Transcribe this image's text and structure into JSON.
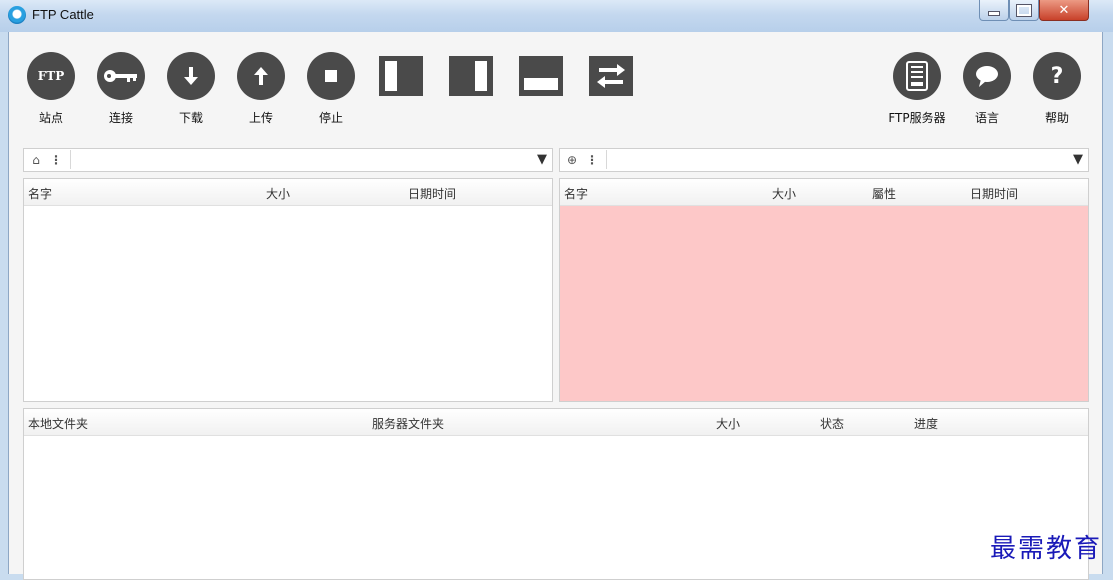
{
  "window": {
    "title": "FTP Cattle"
  },
  "toolbar": {
    "site": "站点",
    "connect": "连接",
    "download": "下载",
    "upload": "上传",
    "stop": "停止",
    "ftp_server": "FTP服务器",
    "language": "语言",
    "help": "帮助",
    "ftp_icon_text": "FTP"
  },
  "local": {
    "columns": [
      "名字",
      "大小",
      "日期时间"
    ],
    "path": ""
  },
  "remote": {
    "columns": [
      "名字",
      "大小",
      "屬性",
      "日期时间"
    ],
    "path": "",
    "background": "#fdc8c8"
  },
  "queue": {
    "columns": [
      "本地文件夹",
      "服务器文件夹",
      "大小",
      "状态",
      "进度"
    ]
  },
  "watermark": "最需教育",
  "icons": {
    "site": "ftp-icon",
    "connect": "key-icon",
    "download": "arrow-down-icon",
    "upload": "arrow-up-icon",
    "stop": "stop-icon",
    "ftp_server": "server-icon",
    "language": "speech-bubble-icon",
    "help": "question-icon"
  }
}
